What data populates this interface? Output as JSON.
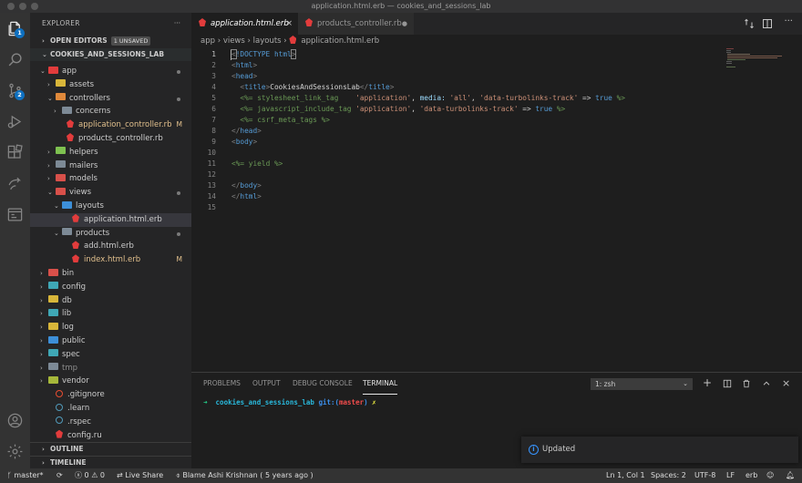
{
  "window": {
    "title": "application.html.erb — cookies_and_sessions_lab"
  },
  "activity": {
    "explorer_badge": "1",
    "scm_badge": "2"
  },
  "sidebar": {
    "title": "EXPLORER",
    "more": "···",
    "open_editors": "OPEN EDITORS",
    "unsaved": "1 UNSAVED",
    "project": "COOKIES_AND_SESSIONS_LAB",
    "outline": "OUTLINE",
    "timeline": "TIMELINE",
    "tree": [
      {
        "label": "app",
        "tri": "⌄",
        "icon": "rb-folder",
        "status": "dot"
      },
      {
        "label": "assets",
        "tri": "›",
        "icon": "folder-yellow"
      },
      {
        "label": "controllers",
        "tri": "⌄",
        "icon": "folder-orange",
        "status": "dot"
      },
      {
        "label": "concerns",
        "tri": "›",
        "icon": "folder-grey"
      },
      {
        "label": "application_controller.rb",
        "tri": "",
        "icon": "ruby",
        "status": "M"
      },
      {
        "label": "products_controller.rb",
        "tri": "",
        "icon": "ruby"
      },
      {
        "label": "helpers",
        "tri": "›",
        "icon": "folder-green"
      },
      {
        "label": "mailers",
        "tri": "›",
        "icon": "folder-grey"
      },
      {
        "label": "models",
        "tri": "›",
        "icon": "folder-red"
      },
      {
        "label": "views",
        "tri": "⌄",
        "icon": "folder-red",
        "status": "dot"
      },
      {
        "label": "layouts",
        "tri": "⌄",
        "icon": "folder-blue"
      },
      {
        "label": "application.html.erb",
        "tri": "",
        "icon": "ruby",
        "selected": true
      },
      {
        "label": "products",
        "tri": "⌄",
        "icon": "folder-grey",
        "status": "dot"
      },
      {
        "label": "add.html.erb",
        "tri": "",
        "icon": "ruby"
      },
      {
        "label": "index.html.erb",
        "tri": "",
        "icon": "ruby",
        "status": "M"
      },
      {
        "label": "bin",
        "tri": "›",
        "icon": "folder-red"
      },
      {
        "label": "config",
        "tri": "›",
        "icon": "folder-teal"
      },
      {
        "label": "db",
        "tri": "›",
        "icon": "folder-yellow"
      },
      {
        "label": "lib",
        "tri": "›",
        "icon": "folder-teal"
      },
      {
        "label": "log",
        "tri": "›",
        "icon": "folder-yellow"
      },
      {
        "label": "public",
        "tri": "›",
        "icon": "folder-blue"
      },
      {
        "label": "spec",
        "tri": "›",
        "icon": "folder-teal"
      },
      {
        "label": "tmp",
        "tri": "›",
        "icon": "folder-grey",
        "dim": true
      },
      {
        "label": "vendor",
        "tri": "›",
        "icon": "folder-yellowgreen"
      },
      {
        "label": ".gitignore",
        "tri": "",
        "icon": "git"
      },
      {
        "label": ".learn",
        "tri": "",
        "icon": "file-blue"
      },
      {
        "label": ".rspec",
        "tri": "",
        "icon": "file-blue"
      },
      {
        "label": "config.ru",
        "tri": "",
        "icon": "ruby"
      }
    ]
  },
  "tabs": [
    {
      "label": "application.html.erb",
      "close": "×",
      "active": true
    },
    {
      "label": "products_controller.rb",
      "close": "●"
    }
  ],
  "breadcrumb": [
    "app",
    "views",
    "layouts",
    "application.html.erb"
  ],
  "code": {
    "line_numbers": [
      "1",
      "2",
      "3",
      "4",
      "5",
      "6",
      "7",
      "8",
      "9",
      "10",
      "11",
      "12",
      "13",
      "14",
      "15"
    ]
  },
  "panel": {
    "tabs": [
      "PROBLEMS",
      "OUTPUT",
      "DEBUG CONSOLE",
      "TERMINAL"
    ],
    "shell": "1: zsh",
    "prompt_arrow": "➜",
    "prompt_dir": "cookies_and_sessions_lab",
    "prompt_git": "git:(",
    "prompt_branch": "master",
    "prompt_git_close": ")",
    "prompt_x": "✗"
  },
  "notification": {
    "text": "Updated"
  },
  "status": {
    "branch": "master*",
    "errors": "0",
    "warnings": "0",
    "live_share": "Live Share",
    "blame": "Blame Ashi Krishnan ( 5 years ago )",
    "position": "Ln 1, Col 1",
    "spaces": "Spaces: 2",
    "encoding": "UTF-8",
    "eol": "LF",
    "language": "erb"
  },
  "colors": {
    "accent": "#0e70c0",
    "ruby": "#e23c3c",
    "modified": "#e2c08d"
  }
}
